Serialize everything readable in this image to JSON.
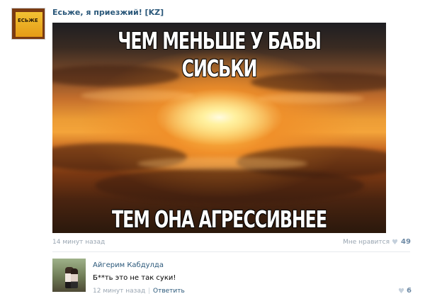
{
  "post": {
    "author": "Есьже, я приезжий! [KZ]",
    "avatar_text": "ЕСЬЖЕ",
    "image_top_text": "ЧЕМ МЕНЬШЕ У БАБЫ СИСЬКИ",
    "image_bottom_text": "ТЕМ ОНА АГРЕССИВНЕЕ",
    "time": "14 минут назад",
    "like_label": "Мне нравится",
    "like_count": "49"
  },
  "comment": {
    "author": "Айгерим Кабдулда",
    "text": "Б**ть это не так суки!",
    "time": "12 минут назад",
    "separator": "|",
    "reply_label": "Ответить",
    "like_count": "6"
  },
  "icons": {
    "heart": "heart-icon"
  }
}
